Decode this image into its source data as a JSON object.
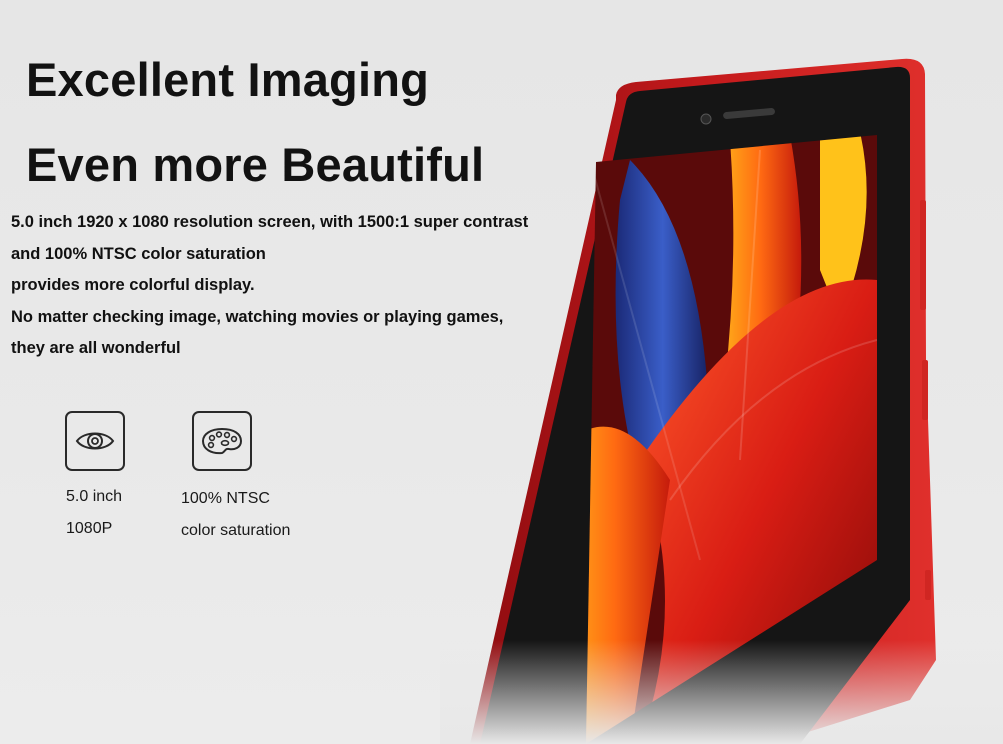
{
  "headline": {
    "line1": "Excellent Imaging",
    "line2": "Even more Beautiful"
  },
  "description": {
    "lines": [
      "5.0 inch 1920 x 1080 resolution screen, with 1500:1 super contrast",
      "and 100% NTSC color saturation",
      "provides more colorful display.",
      "No matter checking image, watching movies or playing games,",
      "they are all wonderful"
    ]
  },
  "features": [
    {
      "icon": "eye-icon",
      "line1": "5.0 inch",
      "line2": "1080P"
    },
    {
      "icon": "palette-icon",
      "line1": "100% NTSC",
      "line2": "color saturation"
    }
  ],
  "colors": {
    "phone_body": "#c41a1c",
    "screen_bezel": "#151515",
    "text": "#111111",
    "background": "#e8e8e8"
  }
}
